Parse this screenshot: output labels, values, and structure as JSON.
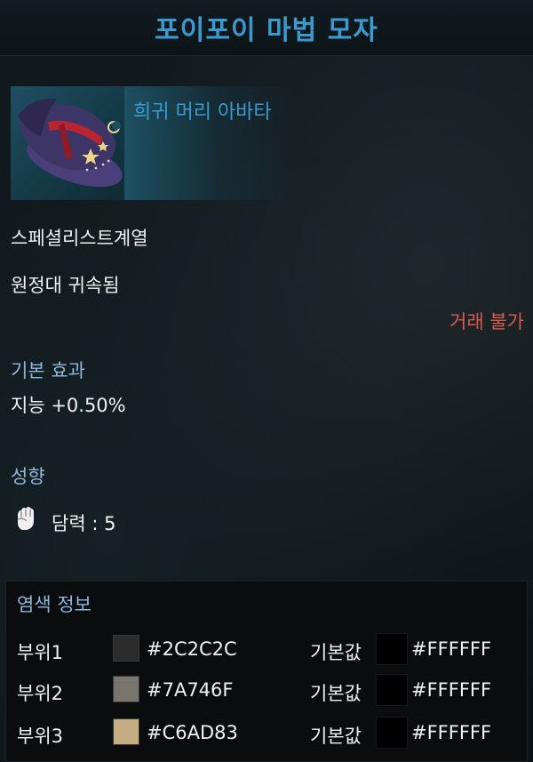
{
  "item": {
    "name": "포이포이 마법 모자",
    "grade_type": "희귀 머리 아바타",
    "class_restriction": "스페셜리스트계열",
    "binding": "원정대 귀속됨",
    "trade": "거래 불가",
    "colors": {
      "title": "#3a9ad0",
      "trade": "#d65a4d",
      "section": "#8fb6dd"
    }
  },
  "basic_effect": {
    "heading": "기본 효과",
    "stat": "지능 +0.50%"
  },
  "tendency": {
    "heading": "성향",
    "icon": "fist-icon",
    "value": "담력 : 5"
  },
  "dye": {
    "heading": "염색 정보",
    "default_label": "기본값",
    "rows": [
      {
        "part": "부위1",
        "color": "#2C2C2C",
        "hex": "#2C2C2C",
        "default_hex": "#FFFFFF"
      },
      {
        "part": "부위2",
        "color": "#7A746F",
        "hex": "#7A746F",
        "default_hex": "#FFFFFF"
      },
      {
        "part": "부위3",
        "color": "#C6AD83",
        "hex": "#C6AD83",
        "default_hex": "#FFFFFF"
      }
    ]
  }
}
